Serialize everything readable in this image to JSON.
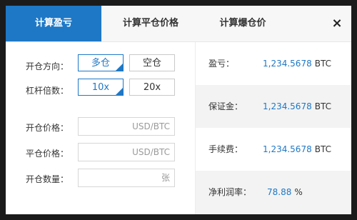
{
  "tabs": [
    {
      "label": "计算盈亏"
    },
    {
      "label": "计算平仓价格"
    },
    {
      "label": "计算爆仓价"
    }
  ],
  "close_glyph": "×",
  "form": {
    "direction_label": "开仓方向：",
    "direction_options": [
      "多仓",
      "空仓"
    ],
    "leverage_label": "杠杆倍数：",
    "leverage_options": [
      "10x",
      "20x"
    ],
    "open_price_label": "开仓价格：",
    "open_price_unit": "USD/BTC",
    "close_price_label": "平仓价格：",
    "close_price_unit": "USD/BTC",
    "quantity_label": "开仓数量：",
    "quantity_unit": "张"
  },
  "results": [
    {
      "label": "盈亏：",
      "value": "1,234.5678",
      "unit": "BTC"
    },
    {
      "label": "保证金：",
      "value": "1,234.5678",
      "unit": "BTC"
    },
    {
      "label": "手续费：",
      "value": "1,234.5678",
      "unit": "BTC"
    },
    {
      "label": "净利润率：",
      "value": "78.88",
      "unit": "%"
    }
  ],
  "colors": {
    "accent": "#1e78c6"
  },
  "icons": {
    "close": "close-icon",
    "selected_corner": "check-corner-icon"
  }
}
